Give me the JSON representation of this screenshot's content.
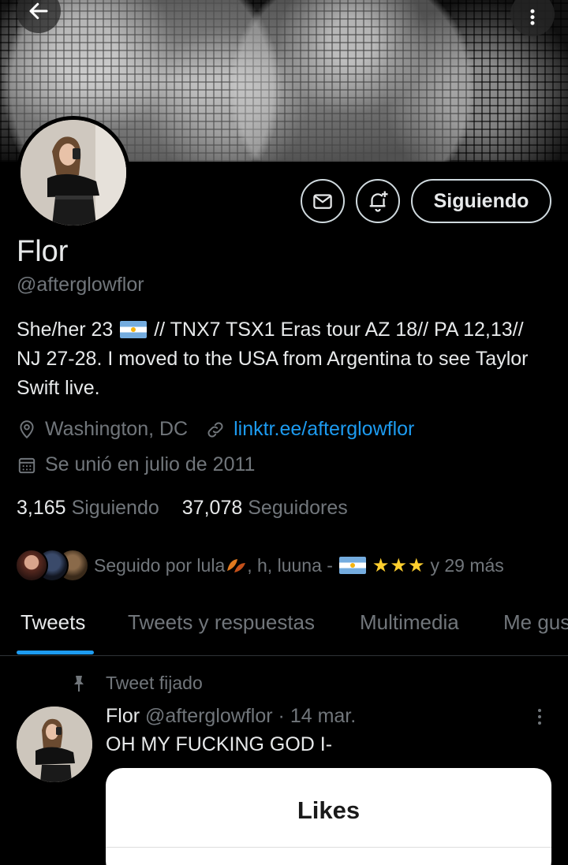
{
  "profile": {
    "name": "Flor",
    "handle": "@afterglowflor",
    "bio_part1": "She/her 23",
    "bio_part2": "// TNX7 TSX1 Eras tour AZ 18// PA 12,13// NJ 27-28. I moved to the USA from Argentina to see Taylor Swift live.",
    "location": "Washington, DC",
    "link": "linktr.ee/afterglowflor",
    "joined": "Se unió en julio de 2011",
    "following_count": "3,165",
    "following_label": "Siguiendo",
    "followers_count": "37,078",
    "followers_label": "Seguidores"
  },
  "actions": {
    "follow_label": "Siguiendo"
  },
  "followed_by": {
    "prefix": "Seguido por lula",
    "middle": ", h, luuna -",
    "stars": "★★★",
    "suffix": "y 29 más"
  },
  "tabs": [
    {
      "label": "Tweets",
      "active": true
    },
    {
      "label": "Tweets y respuestas",
      "active": false
    },
    {
      "label": "Multimedia",
      "active": false
    },
    {
      "label": "Me gus",
      "active": false
    }
  ],
  "pinned_tweet": {
    "pinned_label": "Tweet fijado",
    "author_name": "Flor",
    "author_handle": "@afterglowflor",
    "separator": "·",
    "date": "14 mar.",
    "text": "OH MY FUCKING GOD I-",
    "card_title": "Likes"
  },
  "colors": {
    "background": "#000000",
    "link_blue": "#1d9bf0",
    "muted_text": "#71767b",
    "primary_text": "#e7e9ea",
    "star_yellow": "#ffcf2e"
  },
  "icons": [
    "back-arrow-icon",
    "more-vertical-icon",
    "envelope-icon",
    "bell-plus-icon",
    "location-pin-icon",
    "link-icon",
    "calendar-icon",
    "pin-icon",
    "argentina-flag-icon",
    "leaves-emoji-icon"
  ]
}
